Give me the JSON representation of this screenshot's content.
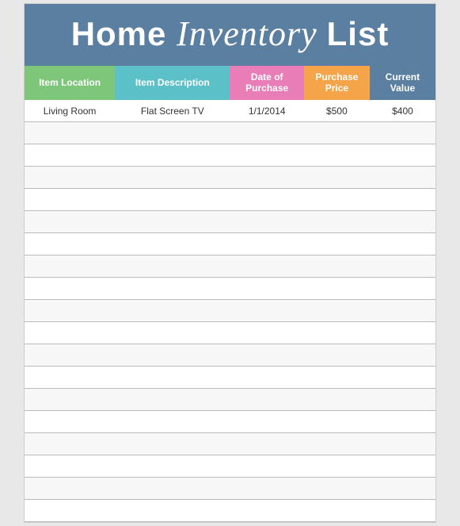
{
  "header": {
    "title_part1": "Home",
    "title_script": "Inventory",
    "title_part2": "List"
  },
  "columns": [
    {
      "id": "location",
      "label": "Item Location",
      "color": "#7dc67a"
    },
    {
      "id": "description",
      "label": "Item Description",
      "color": "#5bc0c8"
    },
    {
      "id": "date",
      "label": "Date of Purchase",
      "color": "#e87db8"
    },
    {
      "id": "purchase_price",
      "label": "Purchase Price",
      "color": "#f5a44a"
    },
    {
      "id": "current_value",
      "label": "Current Value",
      "color": "#5a7fa0"
    }
  ],
  "rows": [
    {
      "location": "Living Room",
      "description": "Flat Screen TV",
      "date": "1/1/2014",
      "purchase_price": "$500",
      "current_value": "$400"
    },
    {
      "location": "",
      "description": "",
      "date": "",
      "purchase_price": "",
      "current_value": ""
    },
    {
      "location": "",
      "description": "",
      "date": "",
      "purchase_price": "",
      "current_value": ""
    },
    {
      "location": "",
      "description": "",
      "date": "",
      "purchase_price": "",
      "current_value": ""
    },
    {
      "location": "",
      "description": "",
      "date": "",
      "purchase_price": "",
      "current_value": ""
    },
    {
      "location": "",
      "description": "",
      "date": "",
      "purchase_price": "",
      "current_value": ""
    },
    {
      "location": "",
      "description": "",
      "date": "",
      "purchase_price": "",
      "current_value": ""
    },
    {
      "location": "",
      "description": "",
      "date": "",
      "purchase_price": "",
      "current_value": ""
    },
    {
      "location": "",
      "description": "",
      "date": "",
      "purchase_price": "",
      "current_value": ""
    },
    {
      "location": "",
      "description": "",
      "date": "",
      "purchase_price": "",
      "current_value": ""
    },
    {
      "location": "",
      "description": "",
      "date": "",
      "purchase_price": "",
      "current_value": ""
    },
    {
      "location": "",
      "description": "",
      "date": "",
      "purchase_price": "",
      "current_value": ""
    },
    {
      "location": "",
      "description": "",
      "date": "",
      "purchase_price": "",
      "current_value": ""
    },
    {
      "location": "",
      "description": "",
      "date": "",
      "purchase_price": "",
      "current_value": ""
    },
    {
      "location": "",
      "description": "",
      "date": "",
      "purchase_price": "",
      "current_value": ""
    },
    {
      "location": "",
      "description": "",
      "date": "",
      "purchase_price": "",
      "current_value": ""
    },
    {
      "location": "",
      "description": "",
      "date": "",
      "purchase_price": "",
      "current_value": ""
    },
    {
      "location": "",
      "description": "",
      "date": "",
      "purchase_price": "",
      "current_value": ""
    },
    {
      "location": "",
      "description": "",
      "date": "",
      "purchase_price": "",
      "current_value": ""
    }
  ]
}
